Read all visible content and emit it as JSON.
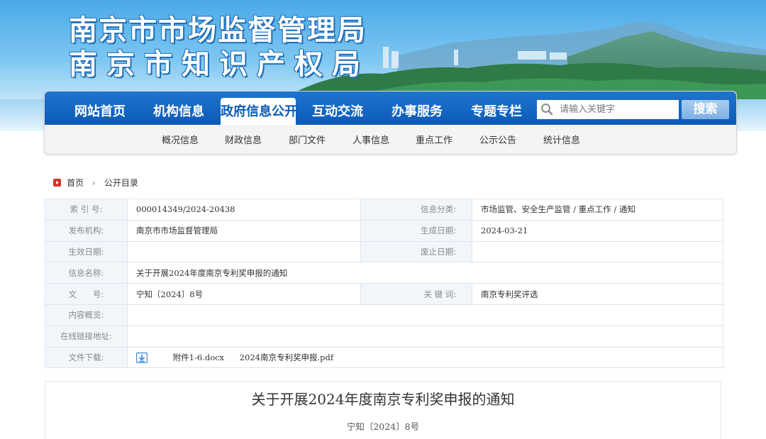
{
  "header": {
    "title_line1": "南京市市场监督管理局",
    "title_line2": "南京市知识产权局",
    "colors": {
      "sky_top": "#4aa9e8",
      "title_outline": "#1f6fb8",
      "nav_blue": "#0b5bb5"
    }
  },
  "nav": {
    "items": [
      {
        "label": "网站首页"
      },
      {
        "label": "机构信息"
      },
      {
        "label": "政府信息公开",
        "active": true
      },
      {
        "label": "互动交流"
      },
      {
        "label": "办事服务"
      },
      {
        "label": "专题专栏"
      }
    ],
    "search": {
      "placeholder": "请输入关键字",
      "button_label": "搜索",
      "icon": "search-icon"
    },
    "sub_items": [
      "概况信息",
      "财政信息",
      "部门文件",
      "人事信息",
      "重点工作",
      "公示公告",
      "统计信息"
    ]
  },
  "breadcrumb": {
    "home": "首页",
    "current": "公开目录",
    "icon": "home-icon"
  },
  "info": {
    "index_label": "索 引 号:",
    "index_value": "000014349/2024-20438",
    "category_label": "信息分类:",
    "category_value": "市场监管、安全生产监管 / 重点工作 / 通知",
    "publisher_label": "发布机构:",
    "publisher_value": "南京市市场监督管理局",
    "created_label": "生成日期:",
    "created_value": "2024-03-21",
    "effective_label": "生效日期:",
    "effective_value": "",
    "expire_label": "废止日期:",
    "expire_value": "",
    "name_label": "信息名称:",
    "name_value": "关于开展2024年度南京专利奖申报的通知",
    "docno_label": "文　　号:",
    "docno_value": "宁知〔2024〕8号",
    "keywords_label": "关 键 词:",
    "keywords_value": "南京专利奖评选",
    "summary_label": "内容概览:",
    "summary_value": "",
    "link_label": "在线链接地址:",
    "link_value": "",
    "download_label": "文件下载:",
    "files": [
      "附件1-6.docx",
      "2024南京专利奖申报.pdf"
    ]
  },
  "article": {
    "title": "关于开展2024年度南京专利奖申报的通知",
    "doc_number": "宁知〔2024〕8号"
  }
}
